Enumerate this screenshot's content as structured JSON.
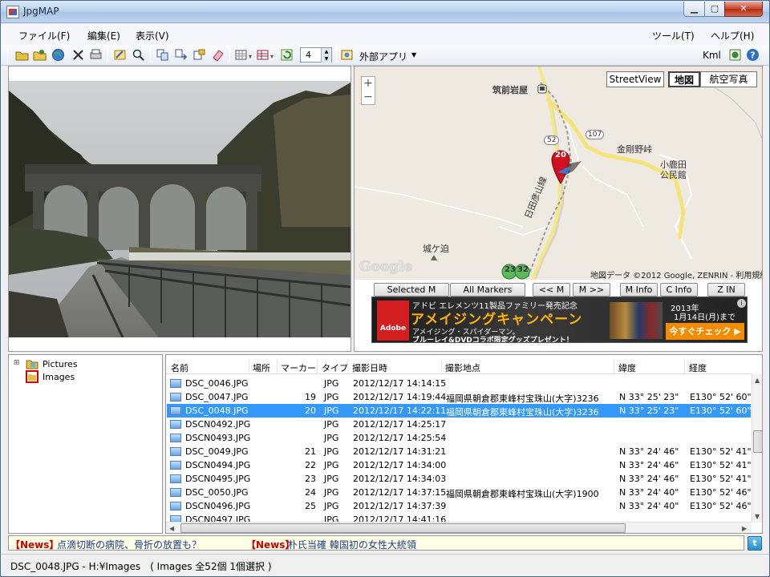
{
  "window": {
    "title": "JpgMAP"
  },
  "menu": {
    "file": "ファイル(F)",
    "edit": "編集(E)",
    "view": "表示(V)",
    "tools": "ツール(T)",
    "help": "ヘルプ(H)"
  },
  "toolbar": {
    "spin_value": "4",
    "external_app": "外部アプリ",
    "kml": "Kml"
  },
  "map": {
    "type_buttons": {
      "street": "StreetView",
      "map": "地図",
      "aerial": "航空写真"
    },
    "labels": {
      "station": "筑前岩屋",
      "kongo": "金剛野峠",
      "koga1": "小鹿田",
      "koga2": "公民館",
      "jogasako": "城ケ迫",
      "hitahikosan": "日田彦山線",
      "route52": "52",
      "route107": "107",
      "marker_selected": "20",
      "marker_23": "23",
      "marker_32": "32"
    },
    "credit": "地図データ ©2012 Google, ZENRIN - 利用規約",
    "google": "Google"
  },
  "map_buttons": {
    "selected": "Selected M",
    "all": "All Markers",
    "prev": "<< M",
    "next": "M >>",
    "minfo": "M Info",
    "cinfo": "C Info",
    "zin": "Z IN"
  },
  "banner": {
    "top": "アドビ エレメンツ11製品ファミリー発売記念",
    "main": "アメイジングキャンペーン",
    "sub1": "アメイジング・スパイダーマン。",
    "sub2": "ブルーレイ&DVDコラボ限定グッズプレゼント！",
    "date1": "2013年",
    "date2": "1月14日(月)まで",
    "cta": "今すぐチェック ▶",
    "logo": "Adobe"
  },
  "tree": {
    "root": "Pictures",
    "child": "Images"
  },
  "list": {
    "headers": [
      "名前",
      "場所",
      "マーカー",
      "タイプ",
      "撮影日時",
      "撮影地点",
      "緯度",
      "経度"
    ],
    "rows": [
      {
        "name": "DSC_0046.JPG",
        "marker": "",
        "type": "JPG",
        "date": "2012/12/17 14:14:15",
        "place": "",
        "lat": "",
        "lon": ""
      },
      {
        "name": "DSC_0047.JPG",
        "marker": "19",
        "type": "JPG",
        "date": "2012/12/17 14:19:44",
        "place": "福岡県朝倉郡東峰村宝珠山(大字)3236",
        "lat": "N 33° 25' 23\"",
        "lon": "E130° 52' 60\""
      },
      {
        "name": "DSC_0048.JPG",
        "marker": "20",
        "type": "JPG",
        "date": "2012/12/17 14:22:11",
        "place": "福岡県朝倉郡東峰村宝珠山(大字)3236",
        "lat": "N 33° 25' 23\"",
        "lon": "E130° 52' 60\""
      },
      {
        "name": "DSCN0492.JPG",
        "marker": "",
        "type": "JPG",
        "date": "2012/12/17 14:25:17",
        "place": "",
        "lat": "",
        "lon": ""
      },
      {
        "name": "DSCN0493.JPG",
        "marker": "",
        "type": "JPG",
        "date": "2012/12/17 14:25:54",
        "place": "",
        "lat": "",
        "lon": ""
      },
      {
        "name": "DSC_0049.JPG",
        "marker": "21",
        "type": "JPG",
        "date": "2012/12/17 14:31:21",
        "place": "",
        "lat": "N 33° 24' 46\"",
        "lon": "E130° 52' 41\""
      },
      {
        "name": "DSCN0494.JPG",
        "marker": "22",
        "type": "JPG",
        "date": "2012/12/17 14:34:00",
        "place": "",
        "lat": "N 33° 24' 46\"",
        "lon": "E130° 52' 41\""
      },
      {
        "name": "DSCN0495.JPG",
        "marker": "23",
        "type": "JPG",
        "date": "2012/12/17 14:34:03",
        "place": "",
        "lat": "N 33° 24' 46\"",
        "lon": "E130° 52' 41\""
      },
      {
        "name": "DSC_0050.JPG",
        "marker": "24",
        "type": "JPG",
        "date": "2012/12/17 14:37:15",
        "place": "福岡県朝倉郡東峰村宝珠山(大字)1900",
        "lat": "N 33° 24' 40\"",
        "lon": "E130° 52' 46\""
      },
      {
        "name": "DSCN0496.JPG",
        "marker": "25",
        "type": "JPG",
        "date": "2012/12/17 14:37:39",
        "place": "",
        "lat": "N 33° 24' 40\"",
        "lon": "E130° 52' 46\""
      },
      {
        "name": "DSCN0497.JPG",
        "marker": "",
        "type": "JPG",
        "date": "2012/12/17 14:41:16",
        "place": "",
        "lat": "",
        "lon": ""
      }
    ]
  },
  "ticker": {
    "news1_tag": "【News】",
    "news1_text": "点滴切断の病院、骨折の放置も？",
    "news2_tag": "【News】",
    "news2_text": "朴氏当確 韓国初の女性大統領"
  },
  "status": {
    "text": "DSC_0048.JPG - H:¥Images　( Images 全52個 1個選択 )"
  },
  "colors": {
    "selection": "#3399ff",
    "news_tag": "#c80000",
    "news_text": "#1a3c8c",
    "marker": "#d0101e"
  }
}
